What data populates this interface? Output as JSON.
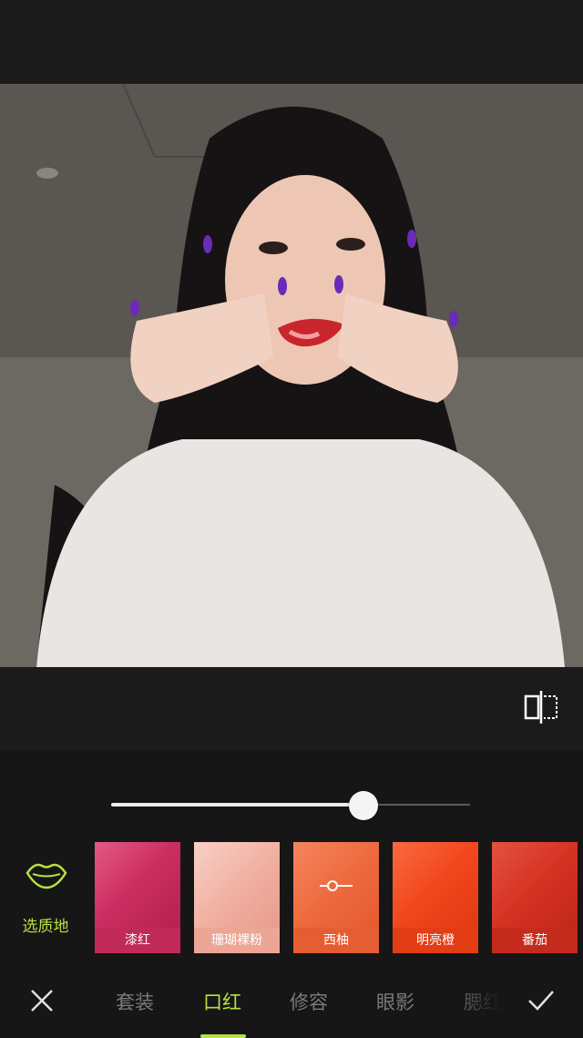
{
  "editor": {
    "slider": {
      "value_fraction": 0.704
    },
    "texture": {
      "icon": "lips-icon",
      "label": "选质地"
    },
    "shades": [
      {
        "label": "漆红",
        "color": "#d23a6d"
      },
      {
        "label": "珊瑚裸粉",
        "color": "#f1b1a4"
      },
      {
        "label": "西柚",
        "color": "#f06a3d",
        "selected": true
      },
      {
        "label": "明亮橙",
        "color": "#f2461d"
      },
      {
        "label": "番茄",
        "color": "#d63223"
      }
    ],
    "tabs": [
      {
        "label": "套装"
      },
      {
        "label": "口红",
        "active": true
      },
      {
        "label": "修容"
      },
      {
        "label": "眼影"
      },
      {
        "label": "腮红"
      }
    ],
    "accent_color": "#b7e041"
  }
}
